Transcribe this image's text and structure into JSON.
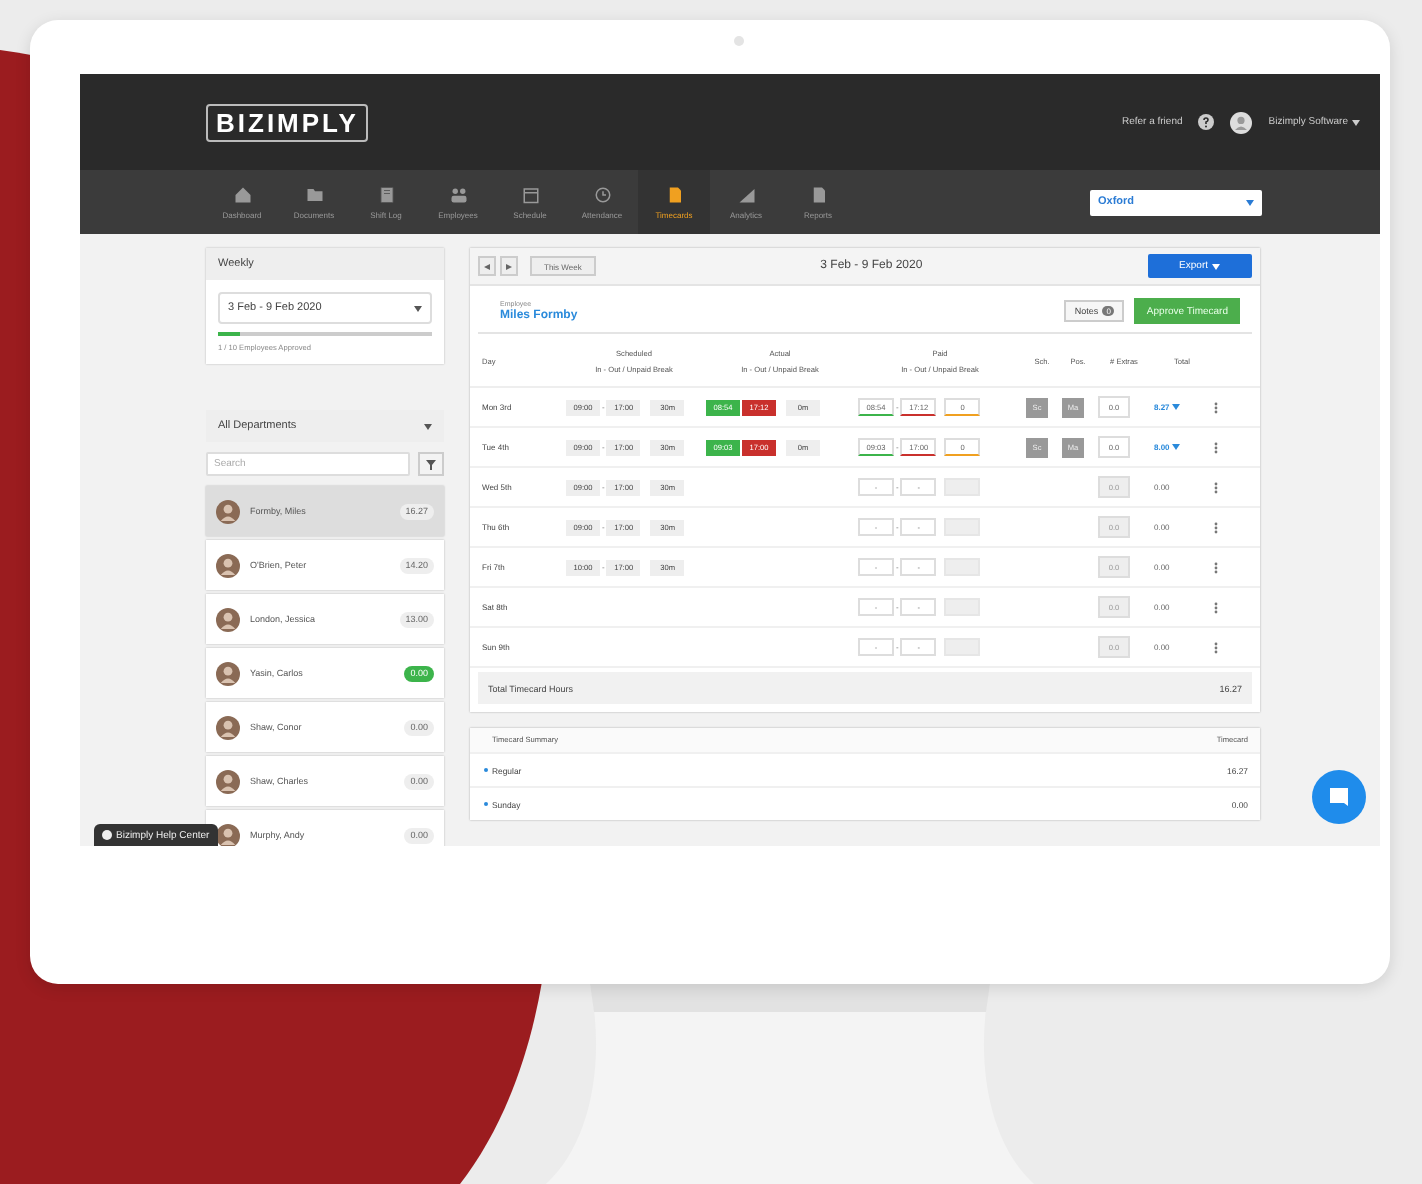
{
  "header": {
    "logo": "BIZIMPLY",
    "refer": "Refer a friend",
    "account": "Bizimply Software"
  },
  "nav": [
    {
      "label": "Dashboard",
      "kind": "home",
      "selected": false
    },
    {
      "label": "Documents",
      "kind": "folder",
      "selected": false
    },
    {
      "label": "Shift Log",
      "kind": "book",
      "selected": false
    },
    {
      "label": "Employees",
      "kind": "people",
      "selected": false
    },
    {
      "label": "Schedule",
      "kind": "calendar",
      "selected": false
    },
    {
      "label": "Attendance",
      "kind": "clock",
      "selected": false
    },
    {
      "label": "Timecards",
      "kind": "doc",
      "selected": true
    },
    {
      "label": "Analytics",
      "kind": "chart",
      "selected": false
    },
    {
      "label": "Reports",
      "kind": "doc",
      "selected": false
    }
  ],
  "location": {
    "value": "Oxford"
  },
  "period": {
    "title": "Weekly",
    "range": "3 Feb - 9 Feb 2020",
    "level": 0.1,
    "approved": "1 / 10 Employees Approved"
  },
  "employees": {
    "department": "All Departments",
    "search_placeholder": "Search",
    "items": [
      {
        "name": "Formby, Miles",
        "hours": "16.27",
        "selected": true,
        "approved": false
      },
      {
        "name": "O'Brien, Peter",
        "hours": "14.20",
        "selected": false,
        "approved": false
      },
      {
        "name": "London, Jessica",
        "hours": "13.00",
        "selected": false,
        "approved": false
      },
      {
        "name": "Yasin, Carlos",
        "hours": "0.00",
        "selected": false,
        "approved": true
      },
      {
        "name": "Shaw, Conor",
        "hours": "0.00",
        "selected": false,
        "approved": false
      },
      {
        "name": "Shaw, Charles",
        "hours": "0.00",
        "selected": false,
        "approved": false
      },
      {
        "name": "Murphy, Andy",
        "hours": "0.00",
        "selected": false,
        "approved": false
      }
    ]
  },
  "timecard": {
    "this_week": "This Week",
    "range": "3 Feb - 9 Feb 2020",
    "export": "Export",
    "employee_label": "Employee",
    "employee": "Miles Formby",
    "notes": "Notes",
    "notes_count": "0",
    "approve": "Approve Timecard",
    "columns": {
      "day": "Day",
      "scheduled": "Scheduled",
      "scheduled_sub": "In - Out / Unpaid Break",
      "actual": "Actual",
      "actual_sub": "In - Out / Unpaid Break",
      "paid": "Paid",
      "paid_sub": "In - Out / Unpaid Break",
      "sch": "Sch.",
      "pos": "Pos.",
      "extras": "# Extras",
      "total": "Total"
    },
    "rows": [
      {
        "kind": "worked",
        "day": "Mon 3rd",
        "scheduled": [
          "09:00",
          "-",
          "17:00",
          "30m"
        ],
        "actual": [
          "08:54",
          "17:12",
          "0m"
        ],
        "paid": [
          "08:54",
          "-",
          "17:12",
          "0"
        ],
        "sch": "Sc",
        "pos": "Ma",
        "extras": "0.0",
        "total": "8.27"
      },
      {
        "kind": "worked",
        "day": "Tue 4th",
        "scheduled": [
          "09:00",
          "-",
          "17:00",
          "30m"
        ],
        "actual": [
          "09:03",
          "17:00",
          "0m"
        ],
        "paid": [
          "09:03",
          "-",
          "17:00",
          "0"
        ],
        "sch": "Sc",
        "pos": "Ma",
        "extras": "0.0",
        "total": "8.00"
      },
      {
        "kind": "open",
        "day": "Wed 5th",
        "scheduled": [
          "09:00",
          "-",
          "17:00",
          "30m"
        ],
        "paid": [
          "-",
          "-",
          "-"
        ],
        "extras": "0.0",
        "total": "0.00"
      },
      {
        "kind": "open",
        "day": "Thu 6th",
        "scheduled": [
          "09:00",
          "-",
          "17:00",
          "30m"
        ],
        "paid": [
          "-",
          "-",
          "-"
        ],
        "extras": "0.0",
        "total": "0.00"
      },
      {
        "kind": "open",
        "day": "Fri 7th",
        "scheduled": [
          "10:00",
          "-",
          "17:00",
          "30m"
        ],
        "paid": [
          "-",
          "-",
          "-"
        ],
        "extras": "0.0",
        "total": "0.00"
      },
      {
        "kind": "open",
        "day": "Sat 8th",
        "paid": [
          "-",
          "-",
          "-"
        ],
        "extras": "0.0",
        "total": "0.00"
      },
      {
        "kind": "open",
        "day": "Sun 9th",
        "paid": [
          "-",
          "-",
          "-"
        ],
        "extras": "0.0",
        "total": "0.00"
      }
    ],
    "total_label": "Total Timecard Hours",
    "total": "16.27"
  },
  "summary": {
    "title": "Timecard Summary",
    "column": "Timecard",
    "rows": [
      {
        "label": "Regular",
        "value": "16.27"
      },
      {
        "label": "Sunday",
        "value": "0.00"
      }
    ]
  },
  "help_center": "Bizimply Help Center"
}
